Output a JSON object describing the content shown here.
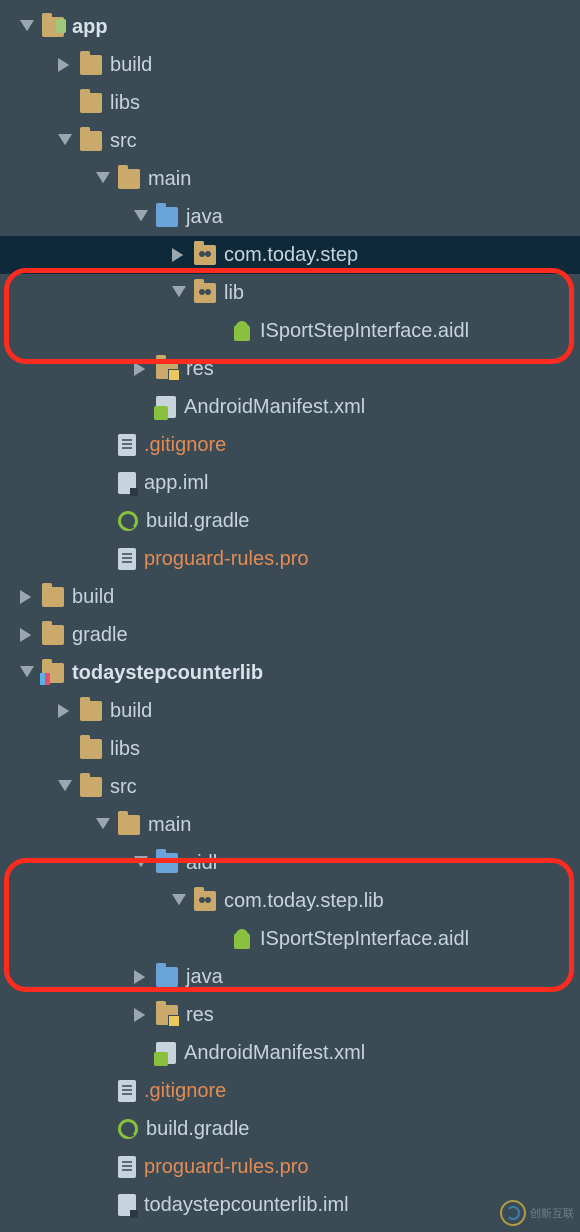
{
  "tree": {
    "app": {
      "name": "app",
      "build": "build",
      "libs": "libs",
      "src": "src",
      "main": "main",
      "java": "java",
      "pkg": "com.today.step",
      "lib": "lib",
      "aidl_file": "ISportStepInterface.aidl",
      "res": "res",
      "manifest": "AndroidManifest.xml",
      "gitignore": ".gitignore",
      "iml": "app.iml",
      "gradle": "build.gradle",
      "proguard": "proguard-rules.pro"
    },
    "root_build": "build",
    "root_gradle": "gradle",
    "lib_module": {
      "name": "todaystepcounterlib",
      "build": "build",
      "libs": "libs",
      "src": "src",
      "main": "main",
      "aidl": "aidl",
      "pkg": "com.today.step.lib",
      "aidl_file": "ISportStepInterface.aidl",
      "java": "java",
      "res": "res",
      "manifest": "AndroidManifest.xml",
      "gitignore": ".gitignore",
      "gradle": "build.gradle",
      "proguard": "proguard-rules.pro",
      "iml": "todaystepcounterlib.iml"
    }
  },
  "watermark": "创新互联"
}
